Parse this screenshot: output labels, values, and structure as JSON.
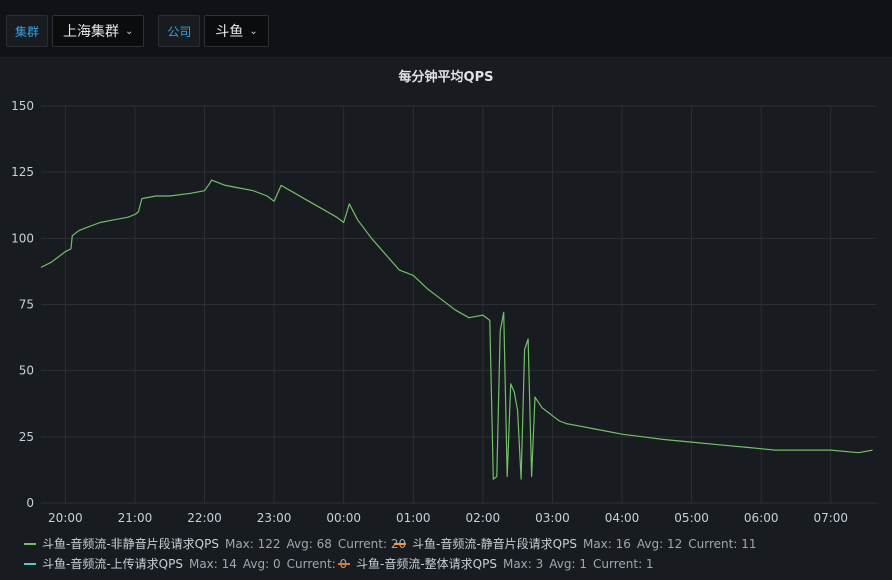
{
  "filters": {
    "cluster_label": "集群",
    "cluster_value": "上海集群",
    "company_label": "公司",
    "company_value": "斗鱼"
  },
  "panel": {
    "title": "每分钟平均QPS"
  },
  "colors": {
    "series1": "#73bf69",
    "series2": "#ff9830",
    "series3": "#5ec4cc",
    "series4": "#e0752d"
  },
  "legend": [
    {
      "name": "斗鱼-音频流-非静音片段请求QPS",
      "max": "Max: 122",
      "avg": "Avg: 68",
      "current": "Current: 20"
    },
    {
      "name": "斗鱼-音频流-静音片段请求QPS",
      "max": "Max: 16",
      "avg": "Avg: 12",
      "current": "Current: 11"
    },
    {
      "name": "斗鱼-音频流-上传请求QPS",
      "max": "Max: 14",
      "avg": "Avg: 0",
      "current": "Current: 0"
    },
    {
      "name": "斗鱼-音频流-整体请求QPS",
      "max": "Max: 3",
      "avg": "Avg: 1",
      "current": "Current: 1"
    }
  ],
  "chart_data": {
    "type": "line",
    "title": "每分钟平均QPS",
    "xlabel": "",
    "ylabel": "",
    "ylim": [
      0,
      150
    ],
    "yticks": [
      0,
      25,
      50,
      75,
      100,
      125,
      150
    ],
    "xticks": [
      "20:00",
      "21:00",
      "22:00",
      "23:00",
      "00:00",
      "01:00",
      "02:00",
      "03:00",
      "04:00",
      "05:00",
      "06:00",
      "07:00"
    ],
    "x_unit": "hours since 20:00",
    "xlim": [
      -0.35,
      11.65
    ],
    "grid": true,
    "legend_position": "bottom",
    "series": [
      {
        "name": "斗鱼-音频流-非静音片段请求QPS",
        "x": [
          -0.35,
          -0.2,
          -0.1,
          0.0,
          0.08,
          0.1,
          0.2,
          0.3,
          0.5,
          0.7,
          0.9,
          1.0,
          1.05,
          1.1,
          1.3,
          1.5,
          1.8,
          2.0,
          2.08,
          2.1,
          2.3,
          2.5,
          2.7,
          2.9,
          3.0,
          3.1,
          3.3,
          3.5,
          3.7,
          3.9,
          4.0,
          4.08,
          4.2,
          4.4,
          4.6,
          4.8,
          5.0,
          5.2,
          5.4,
          5.6,
          5.8,
          6.0,
          6.1,
          6.15,
          6.2,
          6.25,
          6.3,
          6.35,
          6.4,
          6.45,
          6.5,
          6.55,
          6.6,
          6.65,
          6.7,
          6.75,
          6.8,
          6.85,
          6.9,
          6.95,
          7.0,
          7.05,
          7.1,
          7.2,
          7.4,
          7.6,
          7.8,
          8.0,
          8.3,
          8.6,
          9.0,
          9.4,
          9.8,
          10.2,
          10.6,
          11.0,
          11.4,
          11.6
        ],
        "values": [
          89,
          91,
          93,
          95,
          96,
          101,
          103,
          104,
          106,
          107,
          108,
          109,
          110,
          115,
          116,
          116,
          117,
          118,
          121,
          122,
          120,
          119,
          118,
          116,
          114,
          120,
          117,
          114,
          111,
          108,
          106,
          113,
          107,
          100,
          94,
          88,
          86,
          81,
          77,
          73,
          70,
          71,
          69,
          9,
          10,
          65,
          72,
          10,
          45,
          42,
          35,
          9,
          58,
          62,
          10,
          40,
          38,
          36,
          35,
          34,
          33,
          32,
          31,
          30,
          29,
          28,
          27,
          26,
          25,
          24,
          23,
          22,
          21,
          20,
          20,
          20,
          19,
          20
        ]
      }
    ]
  }
}
